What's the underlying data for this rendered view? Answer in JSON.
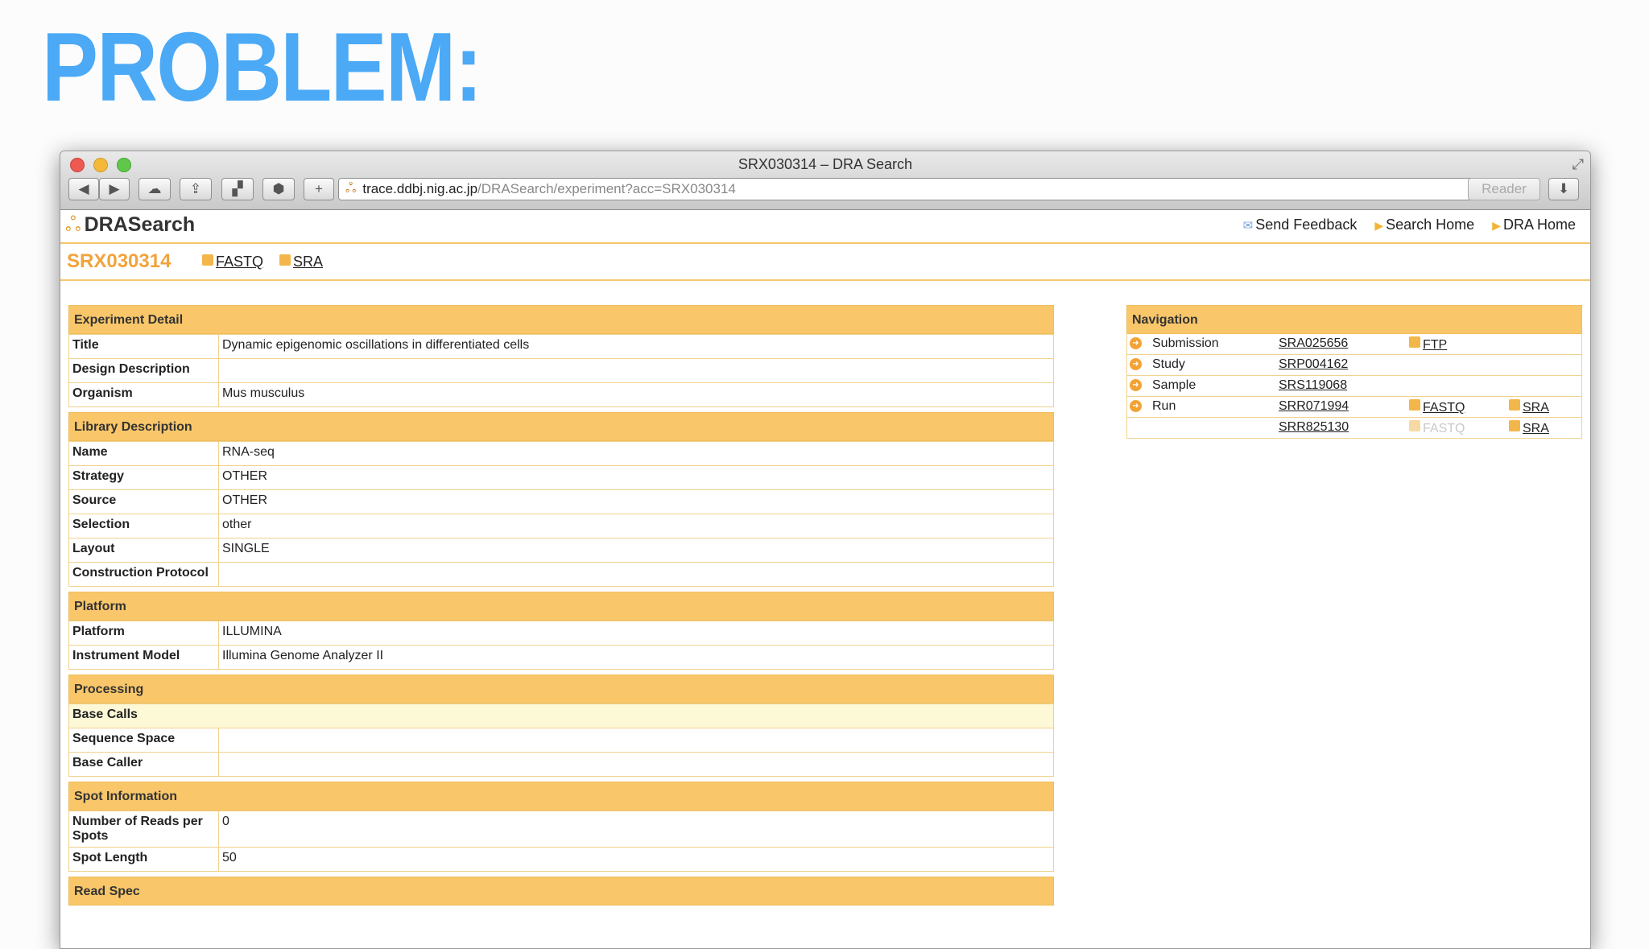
{
  "slide": {
    "title": "PROBLEM:"
  },
  "browser": {
    "window_title": "SRX030314 – DRA Search",
    "url_host": "trace.ddbj.nig.ac.jp",
    "url_path": "/DRASearch/experiment?acc=SRX030314",
    "reader_label": "Reader"
  },
  "site": {
    "logo": "DRASearch",
    "links": {
      "feedback": "Send Feedback",
      "search_home": "Search Home",
      "dra_home": "DRA Home"
    },
    "accession": "SRX030314",
    "downloads": {
      "fastq": "FASTQ",
      "sra": "SRA"
    }
  },
  "experiment_detail": {
    "heading": "Experiment Detail",
    "rows": [
      {
        "k": "Title",
        "v": "Dynamic epigenomic oscillations in differentiated cells"
      },
      {
        "k": "Design Description",
        "v": ""
      },
      {
        "k": "Organism",
        "v": "Mus musculus"
      }
    ]
  },
  "library_description": {
    "heading": "Library Description",
    "rows": [
      {
        "k": "Name",
        "v": "RNA-seq"
      },
      {
        "k": "Strategy",
        "v": "OTHER"
      },
      {
        "k": "Source",
        "v": "OTHER"
      },
      {
        "k": "Selection",
        "v": "other"
      },
      {
        "k": "Layout",
        "v": "SINGLE"
      },
      {
        "k": "Construction Protocol",
        "v": ""
      }
    ]
  },
  "platform": {
    "heading": "Platform",
    "rows": [
      {
        "k": "Platform",
        "v": "ILLUMINA"
      },
      {
        "k": "Instrument Model",
        "v": "Illumina Genome Analyzer II"
      }
    ]
  },
  "processing": {
    "heading": "Processing",
    "base_calls": "Base Calls",
    "rows": [
      {
        "k": "Sequence Space",
        "v": ""
      },
      {
        "k": "Base Caller",
        "v": ""
      }
    ]
  },
  "spot_information": {
    "heading": "Spot Information",
    "rows": [
      {
        "k": "Number of Reads per Spots",
        "v": "0"
      },
      {
        "k": "Spot Length",
        "v": "50"
      }
    ]
  },
  "read_spec": {
    "heading": "Read Spec"
  },
  "navigation": {
    "heading": "Navigation",
    "submission": {
      "label": "Submission",
      "acc": "SRA025656",
      "ftp": "FTP"
    },
    "study": {
      "label": "Study",
      "acc": "SRP004162"
    },
    "sample": {
      "label": "Sample",
      "acc": "SRS119068"
    },
    "run": {
      "label": "Run",
      "acc": "SRR071994",
      "fastq": "FASTQ",
      "sra": "SRA"
    },
    "run2": {
      "acc": "SRR825130",
      "fastq": "FASTQ",
      "sra": "SRA"
    }
  }
}
